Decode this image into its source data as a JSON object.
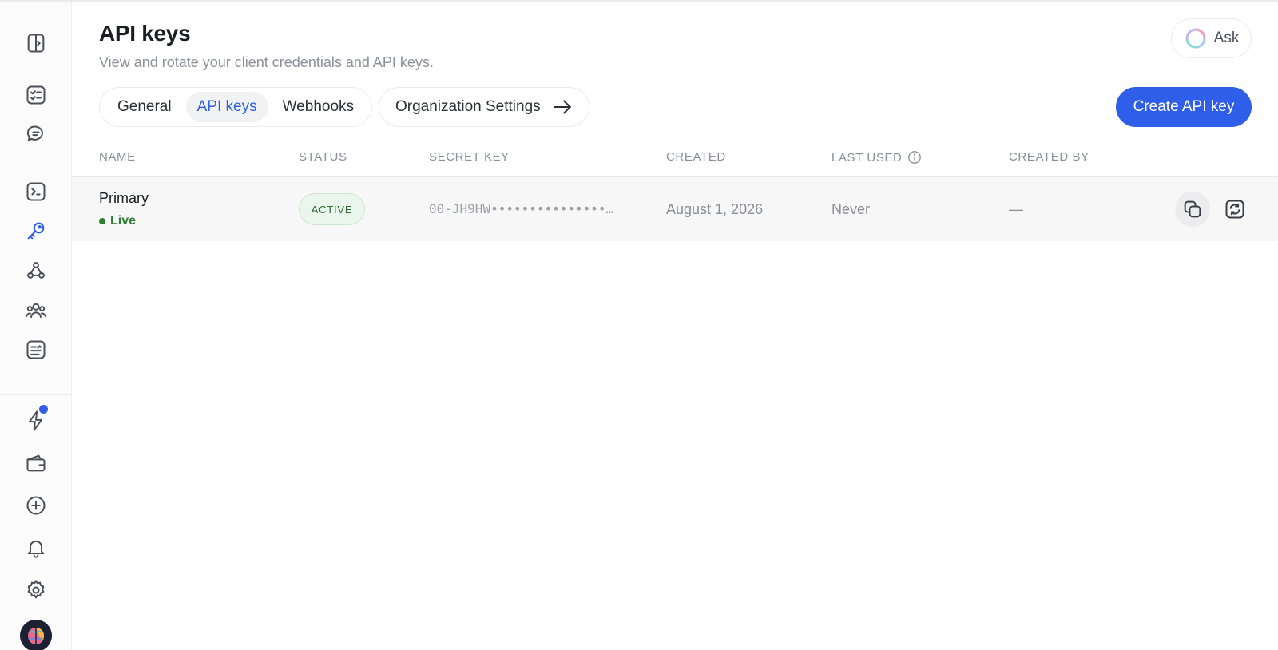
{
  "header": {
    "title": "API keys",
    "subtitle": "View and rotate your client credentials and API keys.",
    "ask_label": "Ask"
  },
  "tabs": [
    {
      "label": "General",
      "active": false
    },
    {
      "label": "API keys",
      "active": true
    },
    {
      "label": "Webhooks",
      "active": false
    }
  ],
  "org_link": {
    "label": "Organization Settings",
    "icon": "arrow-right-icon"
  },
  "create_button": {
    "label": "Create API key"
  },
  "table": {
    "columns": [
      "NAME",
      "STATUS",
      "SECRET KEY",
      "CREATED",
      "LAST USED",
      "CREATED BY"
    ],
    "rows": [
      {
        "name": "Primary",
        "environment": "Live",
        "status": "ACTIVE",
        "secret_key": "00-JH9HW•••••••••••••••…",
        "created": "August 1, 2026",
        "last_used": "Never",
        "created_by": "—"
      }
    ]
  },
  "sidebar": {
    "icons": [
      "sidebar-toggle-icon",
      "checklist-icon",
      "chat-icon",
      "terminal-icon",
      "key-icon",
      "webhook-icon",
      "team-icon",
      "report-icon",
      "bolt-icon",
      "wallet-icon",
      "plus-circle-icon",
      "bell-icon",
      "settings-icon"
    ],
    "active": "key-icon"
  },
  "colors": {
    "accent": "#2f5fe8",
    "success": "#2e7d32",
    "muted": "#8a8f98"
  }
}
